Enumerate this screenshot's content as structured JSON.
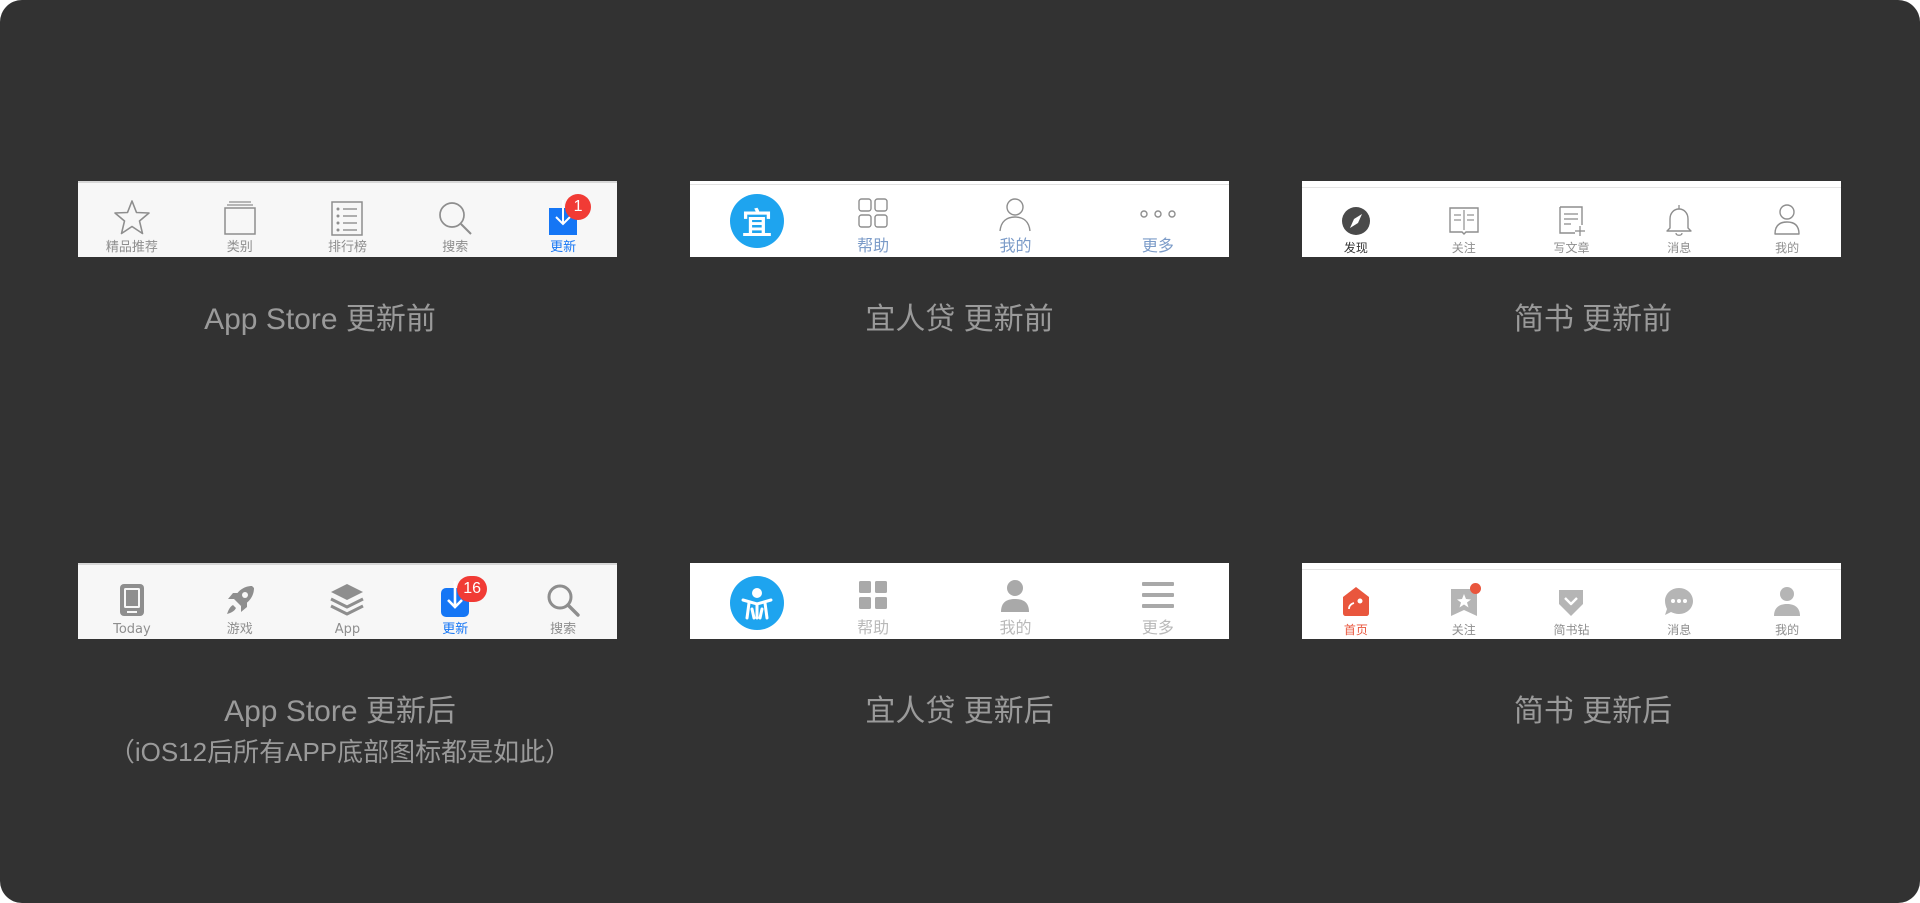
{
  "colors": {
    "background": "#323232",
    "ios_blue": "#1576f5",
    "badge_red": "#f13b35",
    "yrd_blue": "#1ea4ef",
    "yrd_label": "#7b9bc8",
    "jianshu_red": "#e9563d"
  },
  "app_store_old": {
    "caption": "App Store 更新前",
    "tabs": [
      {
        "label": "精品推荐",
        "icon": "star-icon"
      },
      {
        "label": "类别",
        "icon": "stack-icon"
      },
      {
        "label": "排行榜",
        "icon": "list-icon"
      },
      {
        "label": "搜索",
        "icon": "search-icon"
      },
      {
        "label": "更新",
        "icon": "download-icon",
        "badge": "1",
        "active": true
      }
    ]
  },
  "yrd_old": {
    "caption": "宜人贷 更新前",
    "logo_text": "宜",
    "tabs": [
      {
        "label": "帮助",
        "icon": "grid-icon"
      },
      {
        "label": "我的",
        "icon": "user-icon"
      },
      {
        "label": "更多",
        "icon": "more-dots-icon"
      }
    ]
  },
  "jianshu_old": {
    "caption": "简书 更新前",
    "tabs": [
      {
        "label": "发现",
        "icon": "compass-icon",
        "active": true
      },
      {
        "label": "关注",
        "icon": "book-icon"
      },
      {
        "label": "写文章",
        "icon": "write-icon"
      },
      {
        "label": "消息",
        "icon": "bell-icon"
      },
      {
        "label": "我的",
        "icon": "user-icon"
      }
    ]
  },
  "app_store_new": {
    "caption": "App Store 更新后",
    "subcaption": "（iOS12后所有APP底部图标都是如此）",
    "tabs": [
      {
        "label": "Today",
        "icon": "today-icon"
      },
      {
        "label": "游戏",
        "icon": "rocket-icon"
      },
      {
        "label": "App",
        "icon": "layers-icon"
      },
      {
        "label": "更新",
        "icon": "download-icon",
        "badge": "16",
        "active": true
      },
      {
        "label": "搜索",
        "icon": "search-icon"
      }
    ]
  },
  "yrd_new": {
    "caption": "宜人贷 更新后",
    "tabs": [
      {
        "label": "帮助",
        "icon": "grid-icon"
      },
      {
        "label": "我的",
        "icon": "user-icon"
      },
      {
        "label": "更多",
        "icon": "menu-icon"
      }
    ]
  },
  "jianshu_new": {
    "caption": "简书 更新后",
    "tabs": [
      {
        "label": "首页",
        "icon": "home-icon",
        "active": true
      },
      {
        "label": "关注",
        "icon": "bookmark-star-icon",
        "dot": true
      },
      {
        "label": "简书钻",
        "icon": "diamond-icon"
      },
      {
        "label": "消息",
        "icon": "chat-icon"
      },
      {
        "label": "我的",
        "icon": "user-icon"
      }
    ]
  }
}
